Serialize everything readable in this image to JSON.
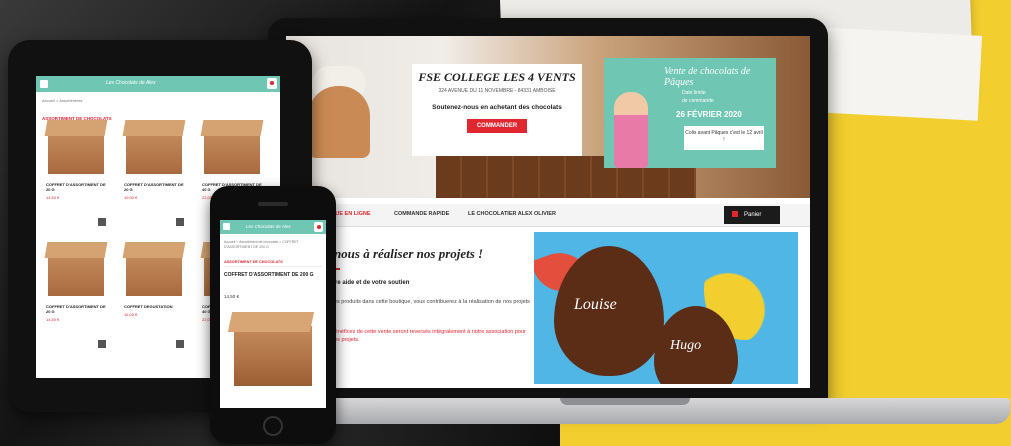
{
  "laptop": {
    "hero": {
      "title": "FSE COLLEGE LES 4 VENTS",
      "address": "324 AVENUE DU 11 NOVEMBRE - 84331 AMBOISE",
      "subtitle": "Soutenez-nous en achetant des chocolats",
      "order_button": "COMMANDER",
      "panel_title": "Vente de chocolats de Pâques",
      "panel_line1": "Date limite",
      "panel_line2": "de commande",
      "panel_date": "26 FÉVRIER 2020",
      "panel_box": "Colis avant Pâques c'est le 12 avril !"
    },
    "nav": {
      "items": [
        "BOUTIQUE EN LIGNE",
        "COMMANDE RAPIDE",
        "LE CHOCOLATIER ALEX OLIVIER"
      ],
      "cart_label": "Panier"
    },
    "content": {
      "title": "Aidez-nous à réaliser nos projets !",
      "heading": "Merci de votre aide et de votre soutien",
      "paragraph": "En achetant des produits dans cette boutique, vous contribuerez à la réalisation de nos projets associatifs.",
      "note": "Tous les bénéfices de cette vente seront reversés intégralement à notre association pour financer nos projets.",
      "egg1_text": "Louise",
      "egg2_text": "Hugo"
    }
  },
  "tablet": {
    "logo": "Les Chocolats de Alex",
    "breadcrumb": "Accueil > Assortiments",
    "category": "ASSORTIMENT DE CHOCOLATS",
    "products": [
      {
        "name": "COFFRET D'ASSORTIMENT DE 20 G",
        "price": "14,50 €"
      },
      {
        "name": "COFFRET D'ASSORTIMENT DE 20 G",
        "price": "19,00 €"
      },
      {
        "name": "COFFRET D'ASSORTIMENT DE 40 G",
        "price": "22,00 €"
      },
      {
        "name": "COFFRET D'ASSORTIMENT DE 20 G",
        "price": "14,50 €"
      },
      {
        "name": "COFFRET DEGUSTATION",
        "price": "16,00 €"
      },
      {
        "name": "COFFRET D'ASSORTIMENT DE 40 G",
        "price": "22,00 €"
      }
    ]
  },
  "phone": {
    "logo": "Les Chocolats de Alex",
    "breadcrumb": "Accueil > Assortiment de chocolats > COFFRET D'ASSORTIMENT DE 200 G",
    "category": "ASSORTIMENT DE CHOCOLATS",
    "product_title": "COFFRET D'ASSORTIMENT DE 200 G",
    "price": "14,50 €"
  }
}
